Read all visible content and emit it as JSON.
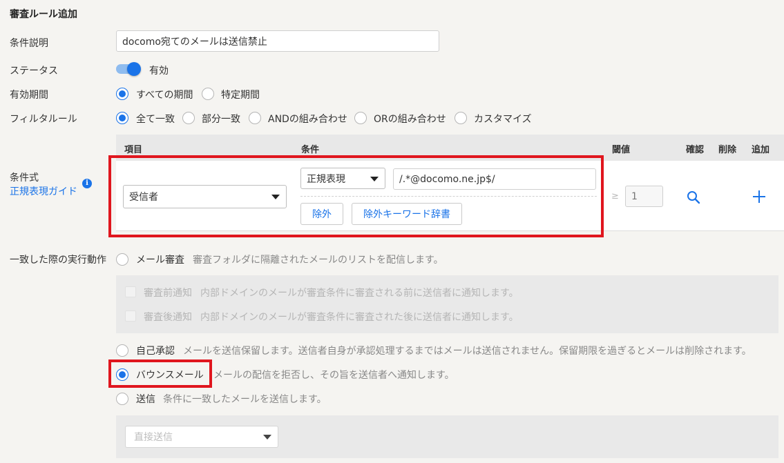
{
  "page": {
    "title": "審査ルール追加"
  },
  "form": {
    "description_label": "条件説明",
    "description_value": "docomo宛てのメールは送信禁止",
    "status_label": "ステータス",
    "status_value": "有効",
    "period_label": "有効期間",
    "period_options": [
      "すべての期間",
      "特定期間"
    ],
    "filter_label": "フィルタルール",
    "filter_options": [
      "全て一致",
      "部分一致",
      "ANDの組み合わせ",
      "ORの組み合わせ",
      "カスタマイズ"
    ],
    "condition_label": "条件式",
    "regex_guide_link": "正規表現ガイド",
    "info_icon_glyph": "i"
  },
  "condition_table": {
    "headers": {
      "item": "項目",
      "condition": "条件",
      "threshold": "閾値",
      "confirm": "確認",
      "delete": "削除",
      "add": "追加"
    },
    "row": {
      "item_value": "受信者",
      "condition_type": "正規表現",
      "condition_value": "/.*@docomo.ne.jp$/",
      "exclude_button": "除外",
      "exclude_dict_button": "除外キーワード辞書",
      "threshold_symbol": "≥",
      "threshold_placeholder": "1"
    }
  },
  "action": {
    "label": "一致した際の実行動作",
    "options": {
      "review": {
        "label": "メール審査",
        "desc": "審査フォルダに隔離されたメールのリストを配信します。"
      },
      "pre_notify": {
        "label": "審査前通知",
        "desc": "内部ドメインのメールが審査条件に審査される前に送信者に通知します。"
      },
      "post_notify": {
        "label": "審査後通知",
        "desc": "内部ドメインのメールが審査条件に審査された後に送信者に通知します。"
      },
      "self_approve": {
        "label": "自己承認",
        "desc": "メールを送信保留します。送信者自身が承認処理するまではメールは送信されません。保留期限を過ぎるとメールは削除されます。"
      },
      "bounce": {
        "label": "バウンスメール",
        "desc": "メールの配信を拒否し、その旨を送信者へ通知します。"
      },
      "send": {
        "label": "送信",
        "desc": "条件に一致したメールを送信します。"
      }
    },
    "send_method_placeholder": "直接送信"
  },
  "colors": {
    "accent": "#1a73e8",
    "highlight": "#e0161e",
    "background": "#f5f4f1"
  }
}
